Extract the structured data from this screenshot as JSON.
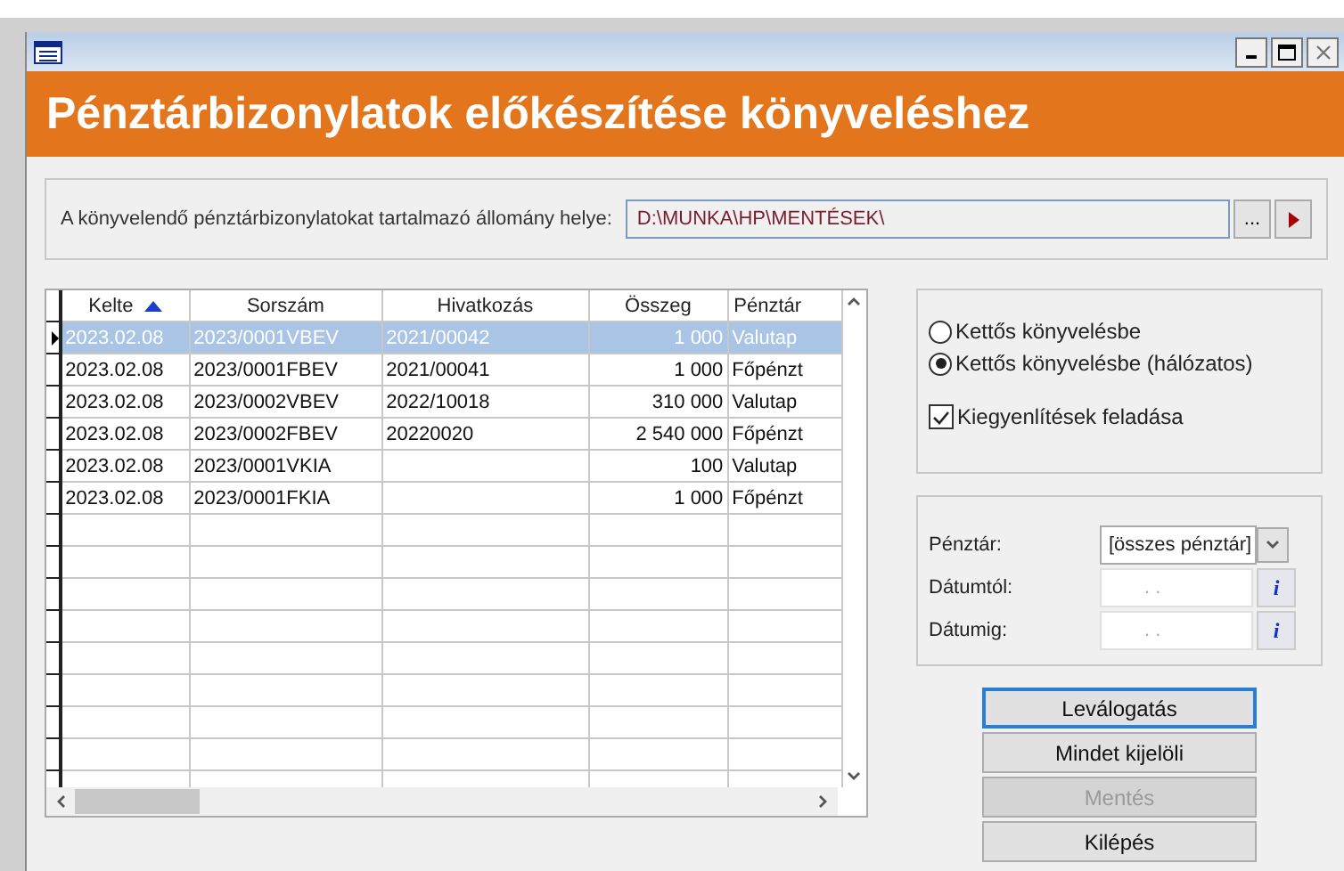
{
  "window": {
    "title": "Pénztárbizonylatok előkészítése könyveléshez"
  },
  "path": {
    "label": "A könyvelendő pénztárbizonylatokat tartalmazó állomány helye:",
    "value": "D:\\MUNKA\\HP\\MENTÉSEK\\",
    "browse": "..."
  },
  "table": {
    "columns": [
      {
        "label": "Kelte",
        "sorted": true
      },
      {
        "label": "Sorszám",
        "sorted": false
      },
      {
        "label": "Hivatkozás",
        "sorted": false
      },
      {
        "label": "Összeg",
        "sorted": false
      },
      {
        "label": "Pénztár",
        "sorted": false
      }
    ],
    "rows": [
      {
        "selected": true,
        "cells": [
          "2023.02.08",
          "2023/0001VBEV",
          "2021/00042",
          "1 000",
          "Valutap"
        ]
      },
      {
        "selected": false,
        "cells": [
          "2023.02.08",
          "2023/0001FBEV",
          "2021/00041",
          "1 000",
          "Főpénzt"
        ]
      },
      {
        "selected": false,
        "cells": [
          "2023.02.08",
          "2023/0002VBEV",
          "2022/10018",
          "310 000",
          "Valutap"
        ]
      },
      {
        "selected": false,
        "cells": [
          "2023.02.08",
          "2023/0002FBEV",
          "20220020",
          "2 540 000",
          "Főpénzt"
        ]
      },
      {
        "selected": false,
        "cells": [
          "2023.02.08",
          "2023/0001VKIA",
          "",
          "100",
          "Valutap"
        ]
      },
      {
        "selected": false,
        "cells": [
          "2023.02.08",
          "2023/0001FKIA",
          "",
          "1 000",
          "Főpénzt"
        ]
      }
    ]
  },
  "options": {
    "radios": [
      {
        "label": "Kettős könyvelésbe",
        "selected": false
      },
      {
        "label": "Kettős könyvelésbe (hálózatos)",
        "selected": true
      }
    ],
    "checkbox": {
      "label": "Kiegyenlítések feladása",
      "checked": true
    }
  },
  "filters": {
    "cashbox": {
      "label": "Pénztár:",
      "value": "[összes pénztár]"
    },
    "dates": [
      {
        "label": "Dátumtól:",
        "placeholder": ". .",
        "info": "i"
      },
      {
        "label": "Dátumig:",
        "placeholder": ". .",
        "info": "i"
      }
    ]
  },
  "buttons": [
    {
      "label": "Leválogatás",
      "disabled": false,
      "focused": true
    },
    {
      "label": "Mindet kijelöli",
      "disabled": false,
      "focused": false
    },
    {
      "label": "Mentés",
      "disabled": true,
      "focused": false
    },
    {
      "label": "Kilépés",
      "disabled": false,
      "focused": false
    }
  ]
}
